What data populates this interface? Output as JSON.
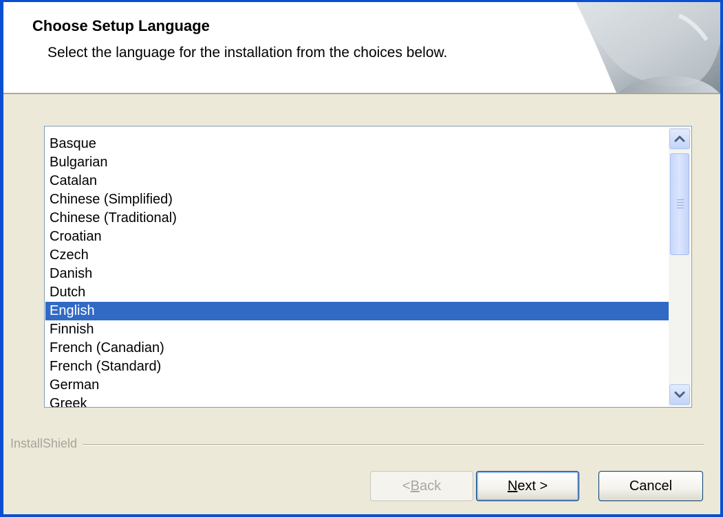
{
  "header": {
    "title": "Choose Setup Language",
    "subtitle": "Select the language for the installation from the choices below."
  },
  "languages": [
    "Basque",
    "Bulgarian",
    "Catalan",
    "Chinese (Simplified)",
    "Chinese (Traditional)",
    "Croatian",
    "Czech",
    "Danish",
    "Dutch",
    "English",
    "Finnish",
    "French (Canadian)",
    "French (Standard)",
    "German",
    "Greek"
  ],
  "selected_language": "English",
  "brand": "InstallShield",
  "buttons": {
    "back": {
      "prefix": "< ",
      "accel": "B",
      "rest": "ack"
    },
    "next": {
      "prefix": "",
      "accel": "N",
      "rest": "ext >"
    },
    "cancel": "Cancel"
  },
  "icons": {
    "scroll_up": "chevron-up-icon",
    "scroll_down": "chevron-down-icon"
  },
  "colors": {
    "frame": "#0a4fd1",
    "dialog_bg": "#ece9d8",
    "selection": "#316ac5"
  }
}
